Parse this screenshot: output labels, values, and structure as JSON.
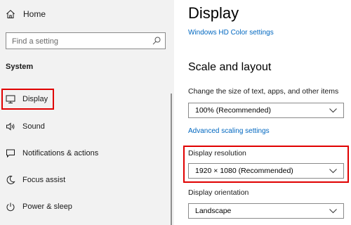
{
  "sidebar": {
    "home_label": "Home",
    "search_placeholder": "Find a setting",
    "section_title": "System",
    "items": [
      {
        "label": "Display",
        "icon": "monitor-icon"
      },
      {
        "label": "Sound",
        "icon": "speaker-icon"
      },
      {
        "label": "Notifications & actions",
        "icon": "notification-icon"
      },
      {
        "label": "Focus assist",
        "icon": "moon-icon"
      },
      {
        "label": "Power & sleep",
        "icon": "power-icon"
      }
    ]
  },
  "main": {
    "title": "Display",
    "hd_color_link": "Windows HD Color settings",
    "scale_heading": "Scale and layout",
    "scale_label": "Change the size of text, apps, and other items",
    "scale_value": "100% (Recommended)",
    "advanced_scaling_link": "Advanced scaling settings",
    "resolution_label": "Display resolution",
    "resolution_value": "1920 × 1080 (Recommended)",
    "orientation_label": "Display orientation",
    "orientation_value": "Landscape"
  },
  "colors": {
    "link": "#0067c0",
    "highlight": "#e00000",
    "sidebar_bg": "#f2f2f2"
  }
}
